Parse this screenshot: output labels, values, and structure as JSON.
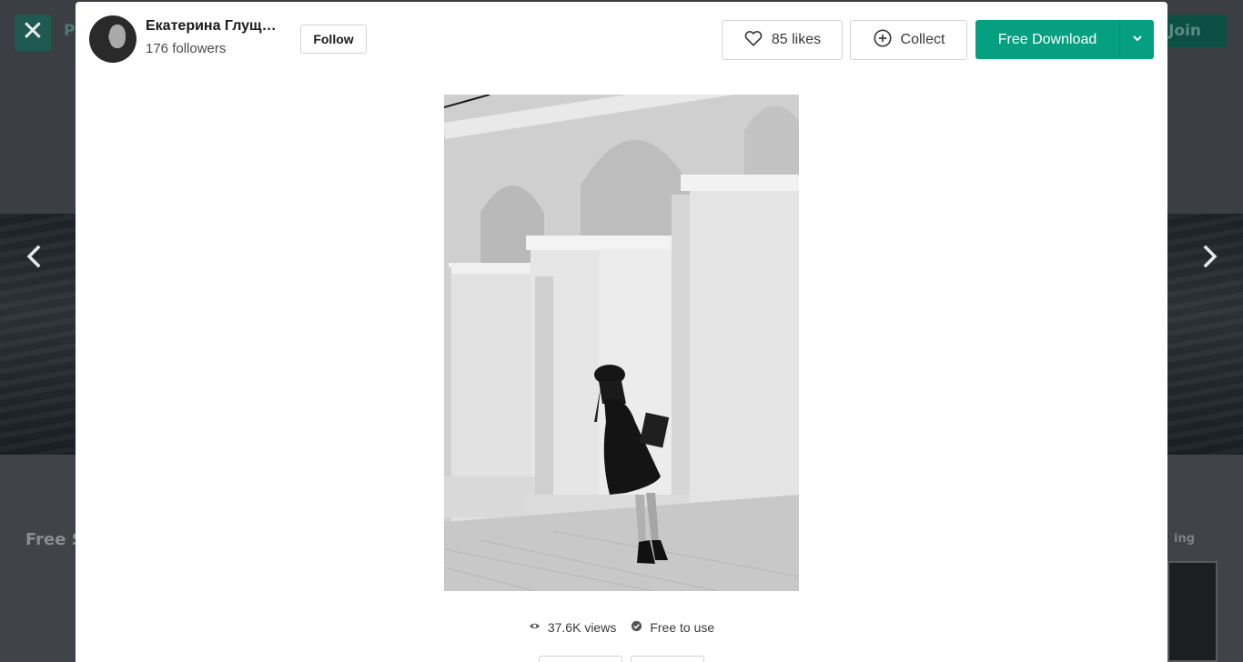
{
  "background": {
    "brand_partial": "P",
    "join_label": "Join",
    "section_title": "Free S",
    "sort_label": "ing"
  },
  "modal": {
    "author": {
      "name": "Екатерина Глущенко",
      "followers": "176 followers",
      "follow_label": "Follow"
    },
    "actions": {
      "likes_label": "85 likes",
      "collect_label": "Collect",
      "download_label": "Free Download"
    },
    "stats": {
      "views": "37.6K views",
      "license": "Free to use"
    }
  },
  "colors": {
    "accent": "#05a081",
    "overlay_bg": "#2b2f33"
  },
  "icons": {
    "close": "close-icon",
    "prev": "chevron-left-icon",
    "next": "chevron-right-icon",
    "like": "heart-icon",
    "collect": "plus-circle-icon",
    "dropdown": "chevron-down-icon",
    "views": "eye-icon",
    "license": "check-circle-icon"
  }
}
